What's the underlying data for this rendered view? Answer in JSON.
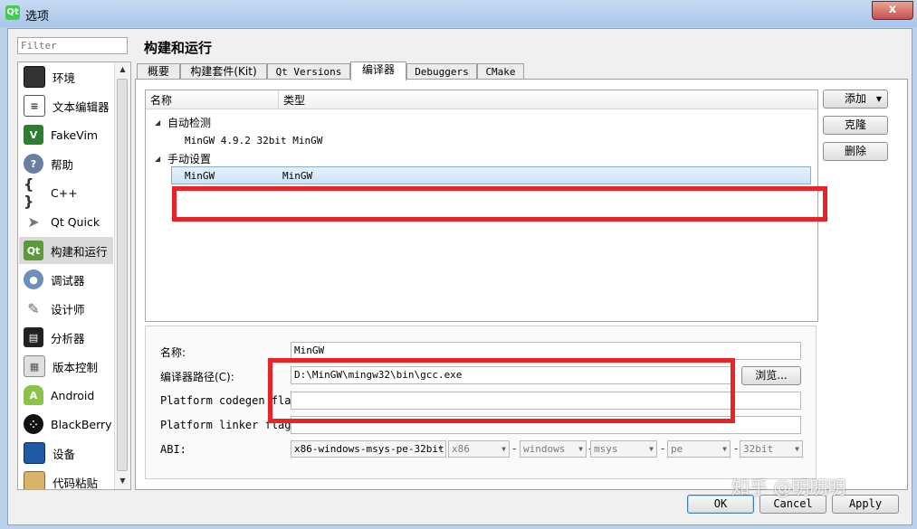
{
  "window": {
    "title": "选项",
    "app_icon": "qt-logo-icon",
    "close_label": "x"
  },
  "filter": {
    "placeholder": "Filter"
  },
  "nav": {
    "items": [
      {
        "label": "环境",
        "icon": "monitor-icon"
      },
      {
        "label": "文本编辑器",
        "icon": "text-editor-icon"
      },
      {
        "label": "FakeVim",
        "icon": "fakevim-icon"
      },
      {
        "label": "帮助",
        "icon": "help-icon"
      },
      {
        "label": "C++",
        "icon": "braces-icon"
      },
      {
        "label": "Qt Quick",
        "icon": "paper-plane-icon"
      },
      {
        "label": "构建和运行",
        "icon": "qt-build-icon"
      },
      {
        "label": "调试器",
        "icon": "debugger-icon"
      },
      {
        "label": "设计师",
        "icon": "designer-icon"
      },
      {
        "label": "分析器",
        "icon": "analyzer-icon"
      },
      {
        "label": "版本控制",
        "icon": "version-control-icon"
      },
      {
        "label": "Android",
        "icon": "android-icon"
      },
      {
        "label": "BlackBerry",
        "icon": "blackberry-icon"
      },
      {
        "label": "设备",
        "icon": "device-icon"
      },
      {
        "label": "代码粘贴",
        "icon": "code-paste-icon"
      }
    ],
    "selected_index": 6
  },
  "page_title": "构建和运行",
  "tabs": [
    {
      "label": "概要"
    },
    {
      "label": "构建套件(Kit)"
    },
    {
      "label": "Qt Versions"
    },
    {
      "label": "编译器"
    },
    {
      "label": "Debuggers"
    },
    {
      "label": "CMake"
    }
  ],
  "active_tab": 3,
  "tree": {
    "col_name": "名称",
    "col_type": "类型",
    "groups": [
      {
        "label": "自动检测",
        "children": [
          {
            "name": "MinGW 4.9.2 32bit MinGW",
            "type": ""
          }
        ]
      },
      {
        "label": "手动设置",
        "children": [
          {
            "name": "MinGW",
            "type": "MinGW"
          }
        ]
      }
    ]
  },
  "side_buttons": {
    "add": "添加",
    "clone": "克隆",
    "delete": "删除"
  },
  "details": {
    "name_label": "名称:",
    "name_value": "MinGW",
    "path_label": "编译器路径(C):",
    "path_value": "D:\\MinGW\\mingw32\\bin\\gcc.exe",
    "browse": "浏览...",
    "codegen_label": "Platform codegen flags:",
    "linker_label": "Platform linker flags:",
    "abi_label": "ABI:",
    "abi_value": "x86-windows-msys-pe-32bit",
    "abi_parts": [
      "x86",
      "windows",
      "msys",
      "pe",
      "32bit"
    ]
  },
  "footer": {
    "ok": "OK",
    "cancel": "Cancel",
    "apply": "Apply"
  },
  "watermark": "知乎 @明明明",
  "colors": {
    "highlight": "#e8232a",
    "selection": "#cde2f8",
    "titlebar": "#b9d1ea"
  }
}
